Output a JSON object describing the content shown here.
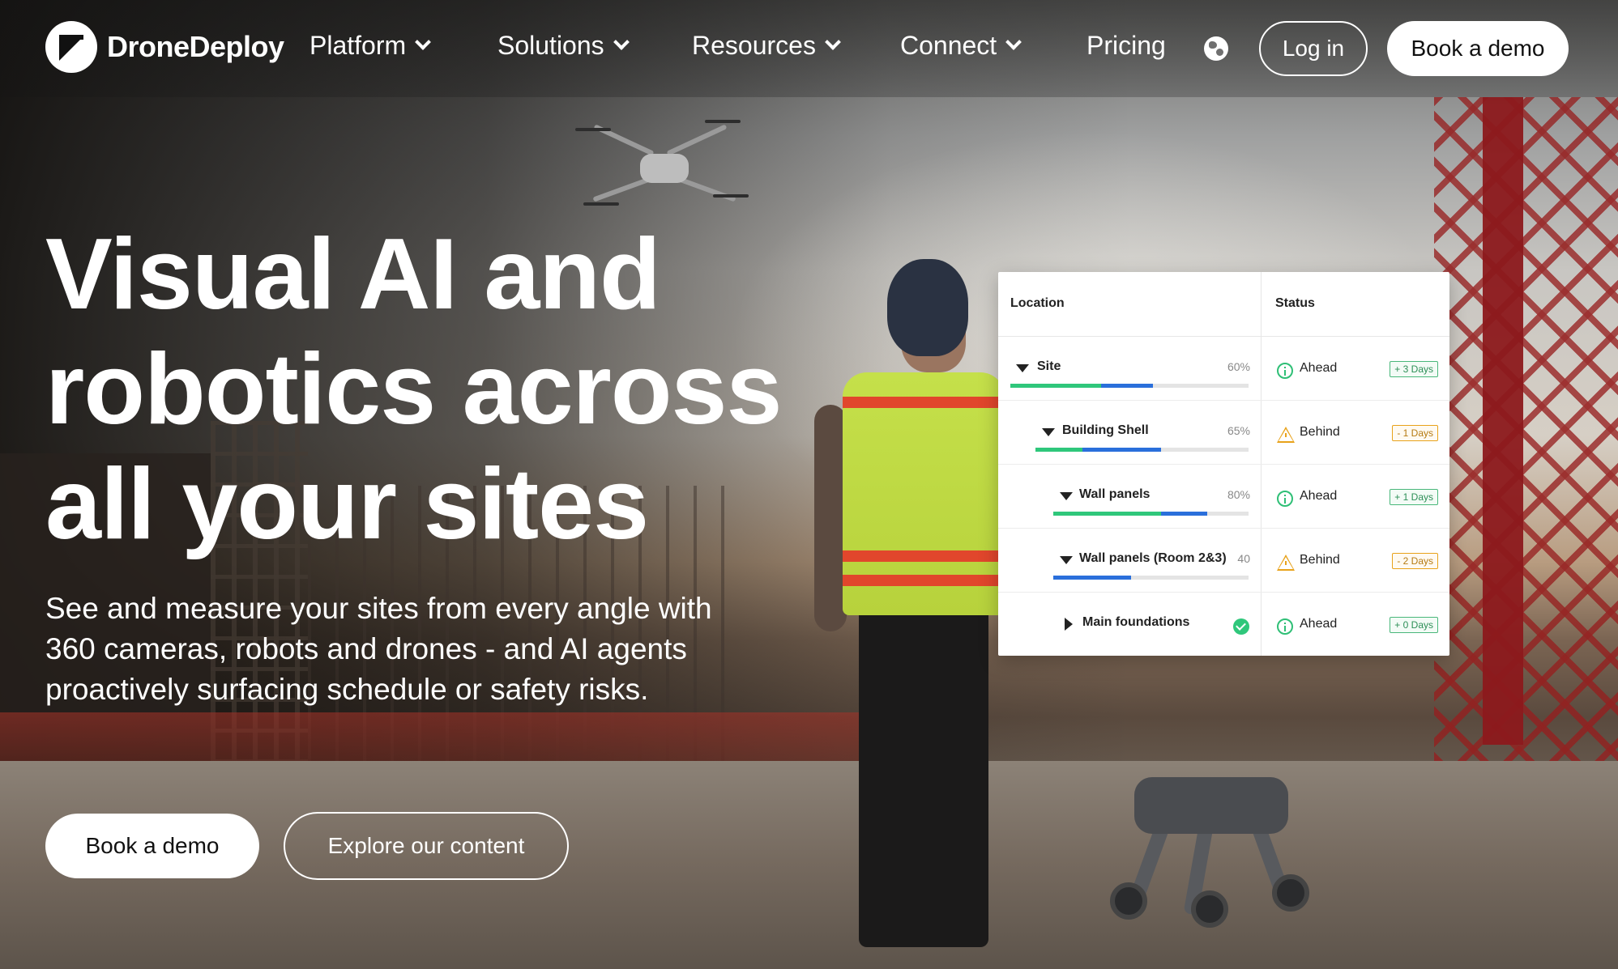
{
  "brand": {
    "name": "DroneDeploy"
  },
  "nav": {
    "items": [
      {
        "label": "Platform",
        "has_dropdown": true
      },
      {
        "label": "Solutions",
        "has_dropdown": true
      },
      {
        "label": "Resources",
        "has_dropdown": true
      },
      {
        "label": "Connect",
        "has_dropdown": true
      },
      {
        "label": "Pricing",
        "has_dropdown": false
      }
    ],
    "globe_icon": "globe-icon",
    "login_label": "Log in",
    "demo_label": "Book a demo"
  },
  "hero": {
    "title_lines": [
      "Visual AI and",
      "robotics across",
      "all your sites"
    ],
    "subtitle": "See and measure your sites from every angle with 360 cameras, robots and drones - and AI agents proactively surfacing schedule or safety risks.",
    "primary_cta": "Book a demo",
    "secondary_cta": "Explore our content"
  },
  "status_table": {
    "headers": {
      "location": "Location",
      "status": "Status"
    },
    "rows": [
      {
        "name": "Site",
        "percent_label": "60%",
        "green": 0.38,
        "blue": 0.22,
        "status": "Ahead",
        "status_type": "ahead",
        "days": "+ 3 Days"
      },
      {
        "name": "Building Shell",
        "percent_label": "65%",
        "green": 0.22,
        "blue": 0.37,
        "status": "Behind",
        "status_type": "behind",
        "days": "- 1 Days"
      },
      {
        "name": "Wall panels",
        "percent_label": "80%",
        "green": 0.55,
        "blue": 0.24,
        "status": "Ahead",
        "status_type": "ahead",
        "days": "+ 1 Days"
      },
      {
        "name": "Wall panels (Room 2&3)",
        "percent_label": "40",
        "green": 0.0,
        "blue": 0.4,
        "status": "Behind",
        "status_type": "behind",
        "days": "- 2 Days"
      },
      {
        "name": "Main foundations",
        "percent_label": "",
        "complete": true,
        "status": "Ahead",
        "status_type": "ahead",
        "days": "+ 0 Days"
      }
    ]
  },
  "colors": {
    "progress_green": "#2fc77b",
    "progress_blue": "#2a6fdb",
    "ahead": "#2fbf76",
    "behind": "#e8a21a"
  }
}
